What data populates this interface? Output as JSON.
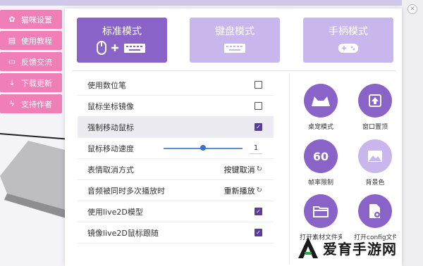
{
  "sidebar": {
    "items": [
      {
        "label": "猫咪设置",
        "icon": "paw-icon"
      },
      {
        "label": "使用教程",
        "icon": "book-icon"
      },
      {
        "label": "反馈交流",
        "icon": "chat-icon"
      },
      {
        "label": "下载更新",
        "icon": "download-icon"
      },
      {
        "label": "支持作者",
        "icon": "lightning-icon"
      }
    ]
  },
  "modes": [
    {
      "label": "标准模式",
      "selected": true,
      "icons": "🖱 + ⌨"
    },
    {
      "label": "键盘模式",
      "selected": false,
      "icons": "⌨"
    },
    {
      "label": "手柄模式",
      "selected": false,
      "icons": "🎮"
    }
  ],
  "settings": [
    {
      "label": "使用数位笔",
      "checked": false
    },
    {
      "label": "鼠标坐标镜像",
      "checked": false
    },
    {
      "label": "强制移动鼠标",
      "checked": true
    },
    {
      "label": "鼠标移动速度",
      "slider_value": "1"
    },
    {
      "label": "表情取消方式",
      "action": "按键取消"
    },
    {
      "label": "音频被同时多次播放时",
      "action": "重新播放"
    },
    {
      "label": "使用live2D模型",
      "checked": true
    },
    {
      "label": "镜像live2D鼠标跟随",
      "checked": true
    }
  ],
  "tiles": [
    {
      "caption": "桌宠模式",
      "icon": "cat-ears-icon",
      "glyph": "▲"
    },
    {
      "caption": "窗口置顶",
      "icon": "pin-top-icon",
      "glyph": "⬆"
    },
    {
      "caption": "帧率限制",
      "icon": "fps-60-icon",
      "glyph": "60"
    },
    {
      "caption": "背景色",
      "icon": "image-icon",
      "glyph": "▨"
    },
    {
      "caption": "打开素材文件夹",
      "icon": "folder-icon",
      "glyph": "📁"
    },
    {
      "caption": "打开config文件",
      "icon": "file-settings-icon",
      "glyph": "⚙"
    }
  ],
  "watermark": {
    "text": "爱育手游网"
  },
  "colors": {
    "accent": "#8a63c8",
    "accent_light": "#c9b6ec",
    "sidebar": "#f07fb8",
    "checkbox": "#5b3d9e"
  }
}
